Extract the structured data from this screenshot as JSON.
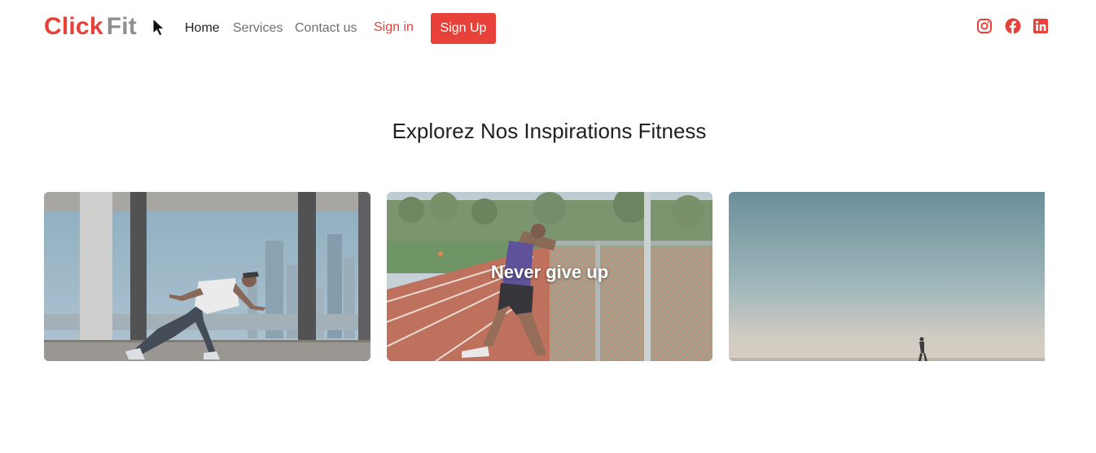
{
  "brand": {
    "part1": "Click",
    "part2": "Fit"
  },
  "nav": {
    "home": "Home",
    "services": "Services",
    "contact": "Contact us",
    "signin": "Sign in",
    "signup": "Sign Up"
  },
  "social": [
    {
      "icon": "instagram-icon"
    },
    {
      "icon": "facebook-icon"
    },
    {
      "icon": "linkedin-icon"
    }
  ],
  "section": {
    "title": "Explorez Nos Inspirations Fitness"
  },
  "cards": [
    {
      "caption": ""
    },
    {
      "caption": "Never give up"
    },
    {
      "caption": ""
    }
  ],
  "colors": {
    "accent": "#e8413a",
    "muted": "#8f8f8f",
    "text": "#222222"
  }
}
